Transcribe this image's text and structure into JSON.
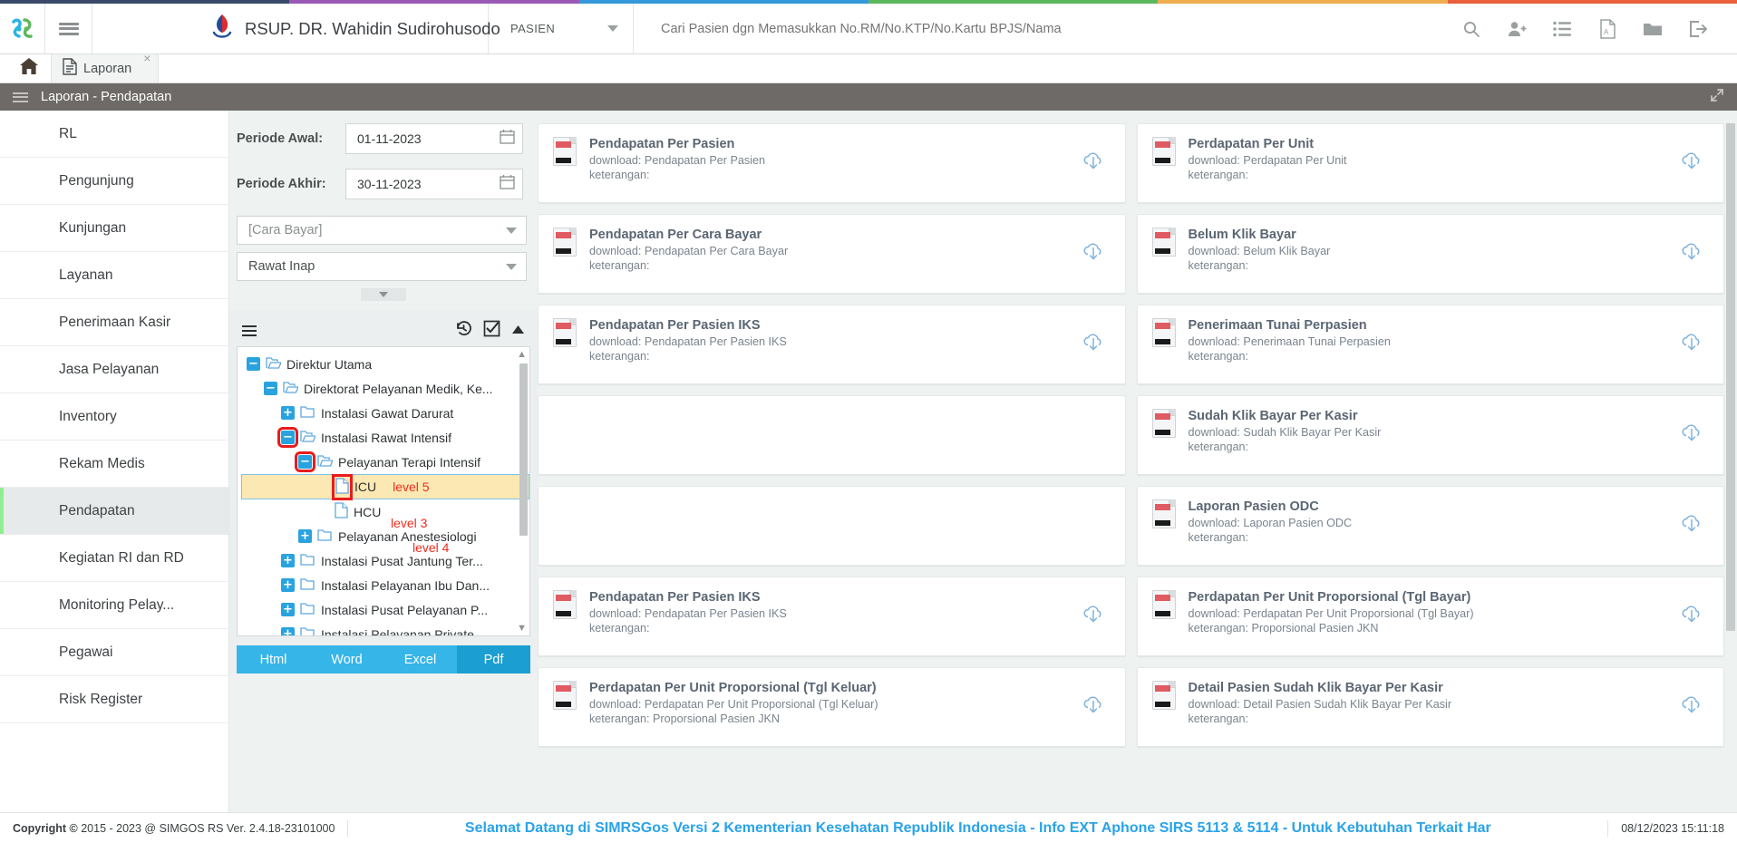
{
  "rainbow": [
    "#3b4a6b",
    "#9b59b6",
    "#3498db",
    "#5cb85c",
    "#f0ad4e",
    "#e8603c"
  ],
  "header": {
    "logo_icon": "simgos-logo-icon",
    "hamburger_icon": "hamburger-icon",
    "hospital_logo_icon": "hospital-logo-icon",
    "brand": "RSUP. DR. Wahidin Sudirohusodo",
    "patient_selector": "PASIEN",
    "search_placeholder": "Cari Pasien dgn Memasukkan No.RM/No.KTP/No.Kartu BPJS/Nama",
    "search_value": "",
    "icons": [
      "search-icon",
      "add-user-icon",
      "list-icon",
      "pdf-icon",
      "folder-icon",
      "logout-icon"
    ]
  },
  "tabs": {
    "home_icon": "home-icon",
    "doc_icon": "document-icon",
    "doc_label": "Laporan",
    "close_label": "×"
  },
  "page_title": {
    "text": "Laporan - Pendapatan",
    "expand_icon": "expand-icon"
  },
  "sidebar": {
    "items": [
      {
        "label": "RL",
        "active": false
      },
      {
        "label": "Pengunjung",
        "active": false
      },
      {
        "label": "Kunjungan",
        "active": false
      },
      {
        "label": "Layanan",
        "active": false
      },
      {
        "label": "Penerimaan Kasir",
        "active": false
      },
      {
        "label": "Jasa Pelayanan",
        "active": false
      },
      {
        "label": "Inventory",
        "active": false
      },
      {
        "label": "Rekam Medis",
        "active": false
      },
      {
        "label": "Pendapatan",
        "active": true
      },
      {
        "label": "Kegiatan RI dan RD",
        "active": false
      },
      {
        "label": "Monitoring Pelay...",
        "active": false
      },
      {
        "label": "Pegawai",
        "active": false
      },
      {
        "label": "Risk Register",
        "active": false
      }
    ]
  },
  "filters": {
    "periode_awal_label": "Periode Awal:",
    "periode_awal_value": "01-11-2023",
    "periode_akhir_label": "Periode Akhir:",
    "periode_akhir_value": "30-11-2023",
    "cara_bayar_value": "[Cara Bayar]",
    "layanan_value": "Rawat Inap",
    "calendar_icon": "calendar-icon",
    "collapse_icon": "chevron-down-icon"
  },
  "tree_toolbar": {
    "list_icon": "list-icon",
    "history_icon": "history-icon",
    "checkbox_icon": "checkbox-checked-icon",
    "collapse_icon": "chevron-up-icon"
  },
  "tree": {
    "nodes": [
      {
        "label": "Direktur Utama",
        "indent": 0,
        "toggle": "minus",
        "folder": "open",
        "highlight": false,
        "redbox_toggle": false,
        "redbox_icon": false,
        "level": ""
      },
      {
        "label": "Direktorat Pelayanan Medik, Ke...",
        "indent": 1,
        "toggle": "minus",
        "folder": "open",
        "highlight": false,
        "redbox_toggle": false,
        "redbox_icon": false,
        "level": ""
      },
      {
        "label": "Instalasi Gawat Darurat",
        "indent": 2,
        "toggle": "plus",
        "folder": "closed",
        "highlight": false,
        "redbox_toggle": false,
        "redbox_icon": false,
        "level": ""
      },
      {
        "label": "Instalasi Rawat Intensif",
        "indent": 2,
        "toggle": "minus",
        "folder": "open",
        "highlight": false,
        "redbox_toggle": true,
        "redbox_icon": false,
        "level": "level 3"
      },
      {
        "label": "Pelayanan Terapi Intensif",
        "indent": 3,
        "toggle": "minus",
        "folder": "open",
        "highlight": false,
        "redbox_toggle": true,
        "redbox_icon": false,
        "level": "level 4"
      },
      {
        "label": "ICU",
        "indent": 4,
        "toggle": "none",
        "folder": "file",
        "highlight": true,
        "redbox_toggle": false,
        "redbox_icon": true,
        "level": "level 5"
      },
      {
        "label": "HCU",
        "indent": 4,
        "toggle": "none",
        "folder": "file",
        "highlight": false,
        "redbox_toggle": false,
        "redbox_icon": false,
        "level": ""
      },
      {
        "label": "Pelayanan Anestesiologi",
        "indent": 3,
        "toggle": "plus",
        "folder": "closed",
        "highlight": false,
        "redbox_toggle": false,
        "redbox_icon": false,
        "level": ""
      },
      {
        "label": "Instalasi Pusat Jantung Ter...",
        "indent": 2,
        "toggle": "plus",
        "folder": "closed",
        "highlight": false,
        "redbox_toggle": false,
        "redbox_icon": false,
        "level": ""
      },
      {
        "label": "Instalasi Pelayanan Ibu Dan...",
        "indent": 2,
        "toggle": "plus",
        "folder": "closed",
        "highlight": false,
        "redbox_toggle": false,
        "redbox_icon": false,
        "level": ""
      },
      {
        "label": "Instalasi Pusat Pelayanan P...",
        "indent": 2,
        "toggle": "plus",
        "folder": "closed",
        "highlight": false,
        "redbox_toggle": false,
        "redbox_icon": false,
        "level": ""
      },
      {
        "label": "Instalasi Pelayanan Private",
        "indent": 2,
        "toggle": "plus",
        "folder": "closed",
        "highlight": false,
        "redbox_toggle": false,
        "redbox_icon": false,
        "level": ""
      }
    ]
  },
  "format_buttons": [
    {
      "label": "Html",
      "active": false
    },
    {
      "label": "Word",
      "active": false
    },
    {
      "label": "Excel",
      "active": false
    },
    {
      "label": "Pdf",
      "active": true
    }
  ],
  "reports": {
    "download_icon": "download-cloud-icon",
    "file_icon": "report-file-icon",
    "left_column": [
      {
        "title": "Pendapatan Per Pasien",
        "download": "download: Pendapatan Per Pasien",
        "keterangan": "keterangan:",
        "blank": false
      },
      {
        "title": "Pendapatan Per Cara Bayar",
        "download": "download: Pendapatan Per Cara Bayar",
        "keterangan": "keterangan:",
        "blank": false
      },
      {
        "title": "Pendapatan Per Pasien IKS",
        "download": "download: Pendapatan Per Pasien IKS",
        "keterangan": "keterangan:",
        "blank": false
      },
      {
        "title": "",
        "download": "",
        "keterangan": "",
        "blank": true
      },
      {
        "title": "",
        "download": "",
        "keterangan": "",
        "blank": true
      },
      {
        "title": "Pendapatan Per Pasien IKS",
        "download": "download: Pendapatan Per Pasien IKS",
        "keterangan": "keterangan:",
        "blank": false
      },
      {
        "title": "Perdapatan Per Unit Proporsional (Tgl Keluar)",
        "download": "download: Perdapatan Per Unit Proporsional (Tgl Keluar)",
        "keterangan": "keterangan: Proporsional Pasien JKN",
        "blank": false
      }
    ],
    "right_column": [
      {
        "title": "Perdapatan Per Unit",
        "download": "download: Perdapatan Per Unit",
        "keterangan": "keterangan:",
        "blank": false
      },
      {
        "title": "Belum Klik Bayar",
        "download": "download: Belum Klik Bayar",
        "keterangan": "keterangan:",
        "blank": false
      },
      {
        "title": "Penerimaan Tunai Perpasien",
        "download": "download: Penerimaan Tunai Perpasien",
        "keterangan": "keterangan:",
        "blank": false
      },
      {
        "title": "Sudah Klik Bayar Per Kasir",
        "download": "download: Sudah Klik Bayar Per Kasir",
        "keterangan": "keterangan:",
        "blank": false
      },
      {
        "title": "Laporan Pasien ODC",
        "download": "download: Laporan Pasien ODC",
        "keterangan": "keterangan:",
        "blank": false
      },
      {
        "title": "Perdapatan Per Unit Proporsional (Tgl Bayar)",
        "download": "download: Perdapatan Per Unit Proporsional (Tgl Bayar)",
        "keterangan": "keterangan: Proporsional Pasien JKN",
        "blank": false
      },
      {
        "title": "Detail Pasien Sudah Klik Bayar Per Kasir",
        "download": "download: Detail Pasien Sudah Klik Bayar Per Kasir",
        "keterangan": "keterangan:",
        "blank": false
      }
    ]
  },
  "footer": {
    "copyright_prefix": "Copyright",
    "copyright_symbol": "©",
    "copyright_text": "2015 - 2023 @ SIMGOS RS Ver. 2.4.18-23101000",
    "marquee": "Selamat Datang di SIMRSGos Versi 2 Kementerian Kesehatan Republik Indonesia - Info EXT Aphone SIRS 5113 & 5114 - Untuk Kebutuhan Terkait Har",
    "clock": "08/12/2023 15:11:18"
  }
}
